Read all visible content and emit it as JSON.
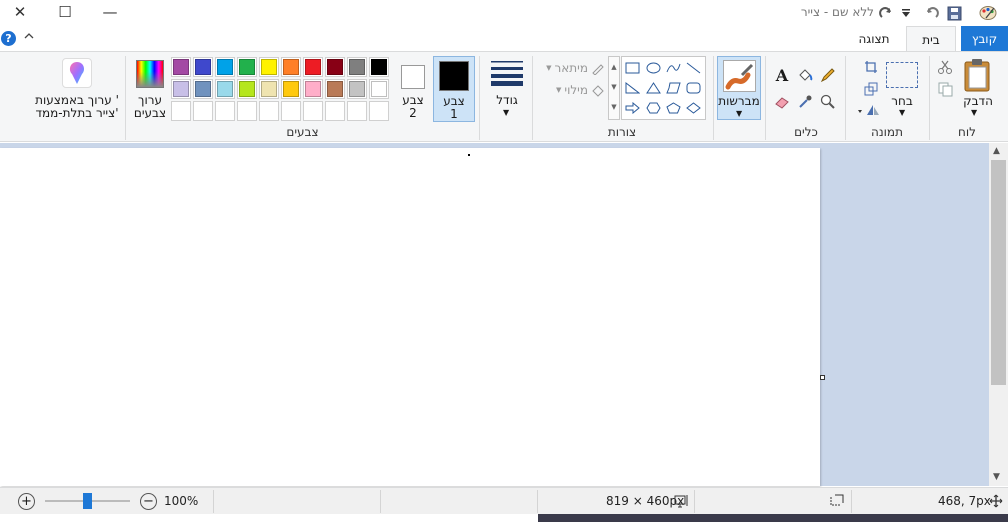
{
  "window": {
    "title": "ללא שם - צייר",
    "minimize_icon": "—",
    "maximize_icon": "☐",
    "close_icon": "✕"
  },
  "tabs": {
    "file": "קובץ",
    "home": "בית",
    "view": "תצוגה"
  },
  "groups": {
    "clipboard": {
      "label": "לוח",
      "paste": "הדבק"
    },
    "image": {
      "label": "תמונה",
      "select": "בחר"
    },
    "tools": {
      "label": "כלים"
    },
    "brushes": {
      "label": "מברשות"
    },
    "shapes": {
      "label": "צורות",
      "outline": "מיתאר",
      "fill": "מילוי"
    },
    "size": {
      "label": "גודל"
    },
    "colors": {
      "label": "צבעים",
      "color1_line1": "צבע",
      "color1_line2": "1",
      "color2_line1": "צבע",
      "color2_line2": "2",
      "edit_colors_line1": "ערוך",
      "edit_colors_line2": "צבעים",
      "edit_3d_line1": "ערוך באמצעות '",
      "edit_3d_line2": "צייר בתלת-ממד'"
    }
  },
  "palette": {
    "row1": [
      "#000000",
      "#7f7f7f",
      "#880015",
      "#ed1c24",
      "#ff7f27",
      "#fff200",
      "#22b14c",
      "#00a2e8",
      "#3f48cc",
      "#a349a4"
    ],
    "row2": [
      "#ffffff",
      "#c3c3c3",
      "#b97a57",
      "#ffaec9",
      "#ffc90e",
      "#efe4b0",
      "#b5e61d",
      "#99d9ea",
      "#7092be",
      "#c8bfe7"
    ],
    "color1": "#000000",
    "color2": "#ffffff"
  },
  "status": {
    "cursor_pos": "468, 7px",
    "image_size": "819 × 460px",
    "zoom": "100%"
  },
  "colors": {
    "accent": "#1e78d6",
    "workspace": "#c9d6e9",
    "ribbon_bg": "#f5f6f7"
  }
}
